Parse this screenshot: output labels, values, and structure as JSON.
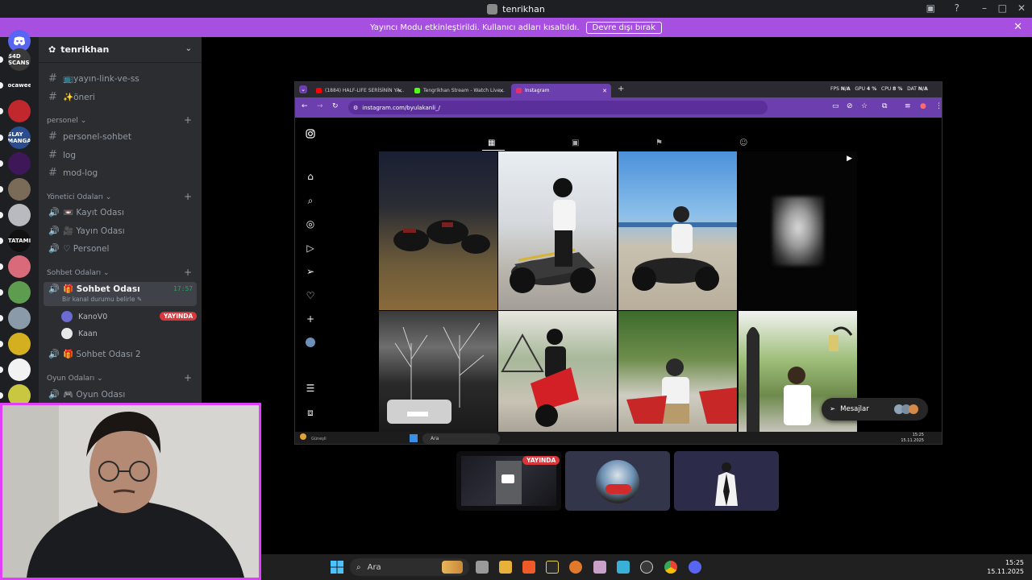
{
  "window": {
    "title": "tenrikhan"
  },
  "banner": {
    "text": "Yayıncı Modu etkinleştirildi. Kullanıcı adları kısaltıldı.",
    "button": "Devre dışı bırak"
  },
  "rail": {
    "servers": [
      {
        "label": "S4D SCANS",
        "color": "#3a3a3a"
      },
      {
        "label": "Gocaweeb",
        "color": "#1e1f22"
      },
      {
        "label": "",
        "color": "#c0282d"
      },
      {
        "label": "SLAY MANGA",
        "color": "#2a4d8f"
      },
      {
        "label": "",
        "color": "#3d1758"
      },
      {
        "label": "",
        "color": "#7a6a58"
      },
      {
        "label": "",
        "color": "#b9b9c0"
      },
      {
        "label": "TATAMI",
        "color": "#111111"
      },
      {
        "label": "",
        "color": "#d96a7a"
      },
      {
        "label": "",
        "color": "#5e9c4f"
      },
      {
        "label": "",
        "color": "#8a9aa8"
      },
      {
        "label": "",
        "color": "#d4b020"
      },
      {
        "label": "",
        "color": "#f2f2f2"
      },
      {
        "label": "",
        "color": "#c9c740"
      }
    ]
  },
  "sidebar": {
    "guild": "tenrikhan",
    "channels_top": [
      "📺yayın-link-ve-ss",
      "✨öneri"
    ],
    "cat_personel": "personel",
    "personel_channels": [
      "personel-sohbet",
      "log",
      "mod-log"
    ],
    "cat_yonetici": "Yönetici Odaları",
    "yonetici_voice": [
      "📼 Kayıt Odası",
      "🎥 Yayın Odası",
      "♡ Personel"
    ],
    "cat_sohbet": "Sohbet Odaları",
    "active_voice": "🎁 Sohbet Odası",
    "active_time": "17:57",
    "status_placeholder": "Bir kanal durumu belirle",
    "users": [
      "KanoV0",
      "Kaan"
    ],
    "live_badge": "YAYINDA",
    "voice2": "🎁 Sohbet Odası 2",
    "cat_oyun": "Oyun Odaları",
    "oyun_voice": "🎮 Oyun Odası"
  },
  "browser": {
    "tabs": [
      "(1884) HALF-LIFE SERİSİNİN YA...",
      "Tengrikhan Stream - Watch Live...",
      "Instagram"
    ],
    "url": "instagram.com/byulakanli_/",
    "perf": {
      "fps_label": "FPS",
      "fps": "N/A",
      "gpu_label": "GPU",
      "gpu": "4 %",
      "cpu_label": "CPU",
      "cpu": "8 %",
      "dat_label": "DAT",
      "dat": "N/A"
    },
    "messages": "Mesajlar",
    "task_search": "Ara",
    "task_weather": "Güneşli",
    "task_time": "15:25",
    "task_date": "15.11.2025"
  },
  "stage": {
    "live_badge": "YAYINDA"
  },
  "taskbar": {
    "search": "Ara",
    "time": "15:25",
    "date": "15.11.2025"
  }
}
